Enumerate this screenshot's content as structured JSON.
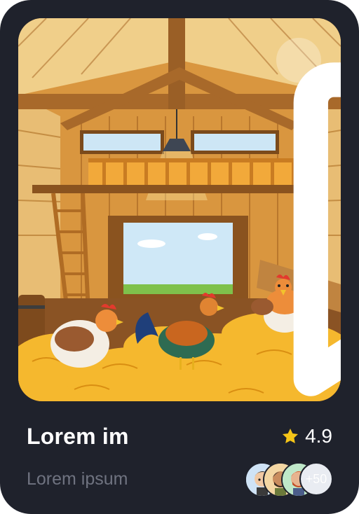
{
  "card": {
    "title": "Lorem im",
    "subtitle": "Lorem ipsum",
    "rating": "4.9",
    "participants_more": "+50",
    "colors": {
      "background": "#1f222c",
      "star": "#f5c518",
      "title": "#ffffff",
      "subtitle": "#6f7380"
    }
  },
  "icons": {
    "bookmark": "bookmark-icon",
    "star": "star-icon"
  },
  "image": {
    "subject": "barn-with-chickens-illustration"
  }
}
